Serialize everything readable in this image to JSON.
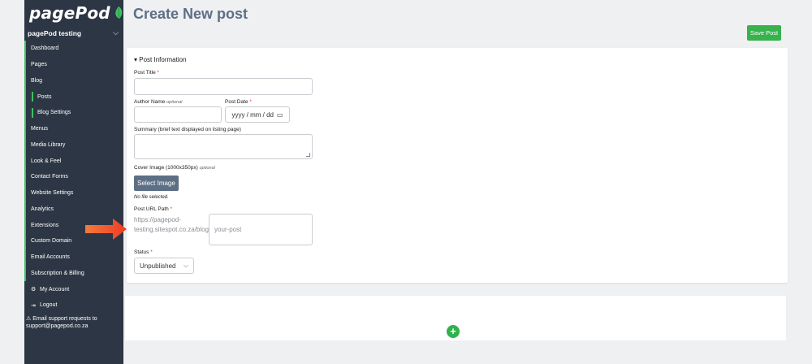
{
  "app": {
    "logo_text": "pagePod",
    "site_name": "pagePod testing"
  },
  "sidebar": {
    "items": [
      {
        "label": "Dashboard"
      },
      {
        "label": "Pages"
      },
      {
        "label": "Blog"
      },
      {
        "label": "Posts"
      },
      {
        "label": "Blog Settings"
      },
      {
        "label": "Menus"
      },
      {
        "label": "Media Library"
      },
      {
        "label": "Look & Feel"
      },
      {
        "label": "Contact Forms"
      },
      {
        "label": "Website Settings"
      },
      {
        "label": "Analytics"
      },
      {
        "label": "Extensions"
      },
      {
        "label": "Custom Domain"
      },
      {
        "label": "Email Accounts"
      },
      {
        "label": "Subscription & Billing"
      },
      {
        "label": "My Account",
        "icon": "gear-icon"
      },
      {
        "label": "Logout",
        "icon": "logout-icon"
      }
    ],
    "support_text": "Email support requests to support@pagepod.co.za"
  },
  "header": {
    "title": "Create New post",
    "save_label": "Save Post"
  },
  "form": {
    "section_title": "▾ Post Information",
    "post_title_label": "Post Title",
    "author_label": "Author Name",
    "optional": "optional",
    "post_date_label": "Post Date",
    "post_date_placeholder": "yyyy / mm / dd",
    "summary_label": "Summary (brief text displayed on listing page)",
    "cover_label": "Cover Image (1000x350px)",
    "select_image_label": "Select Image",
    "no_file_text": "No file selected.",
    "url_label": "Post URL Path",
    "url_prefix": "https://pagepod-testing.sitespot.co.za/blog/",
    "url_placeholder": "your-post",
    "status_label": "Status",
    "status_value": "Unpublished",
    "required_mark": "*"
  },
  "colors": {
    "sidebar_bg": "#2d3644",
    "accent_green": "#37b24d",
    "title_color": "#5d6f84",
    "arrow": "#f05a28"
  }
}
